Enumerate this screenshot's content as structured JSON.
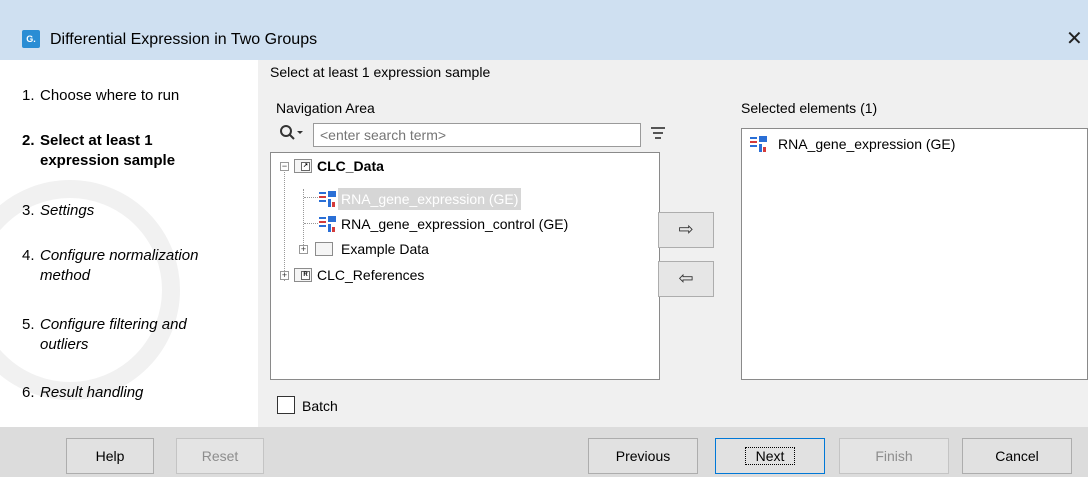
{
  "window": {
    "title": "Differential Expression in Two Groups",
    "app_icon_text": "G.",
    "close_glyph": "✕"
  },
  "steps": [
    {
      "num": "1.",
      "label": "Choose where to run"
    },
    {
      "num": "2.",
      "label": "Select at least 1 expression sample"
    },
    {
      "num": "3.",
      "label": "Settings"
    },
    {
      "num": "4.",
      "label": "Configure normalization method"
    },
    {
      "num": "5.",
      "label": "Configure filtering and outliers"
    },
    {
      "num": "6.",
      "label": "Result handling"
    }
  ],
  "section_title": "Select at least 1 expression sample",
  "navigation": {
    "label": "Navigation Area",
    "search_placeholder": "<enter search term>",
    "tree": {
      "root1": "CLC_Data",
      "item1": "RNA_gene_expression (GE)",
      "item2": "RNA_gene_expression_control (GE)",
      "folder1": "Example Data",
      "root2": "CLC_References"
    }
  },
  "arrows": {
    "add": "⇨",
    "remove": "⇦"
  },
  "selected": {
    "label": "Selected elements (1)",
    "items": [
      "RNA_gene_expression (GE)"
    ]
  },
  "batch_label": "Batch",
  "buttons": {
    "help": "Help",
    "reset": "Reset",
    "previous": "Previous",
    "next": "Next",
    "finish": "Finish",
    "cancel": "Cancel"
  },
  "icons": {
    "app": "clc-app-icon",
    "search": "search-icon",
    "filter": "filter-icon",
    "folder": "folder-icon",
    "expression": "gene-expression-icon"
  },
  "colors": {
    "titlebar": "#cfe0f1",
    "accent": "#0078d7",
    "selection": "#d6d6d6"
  }
}
